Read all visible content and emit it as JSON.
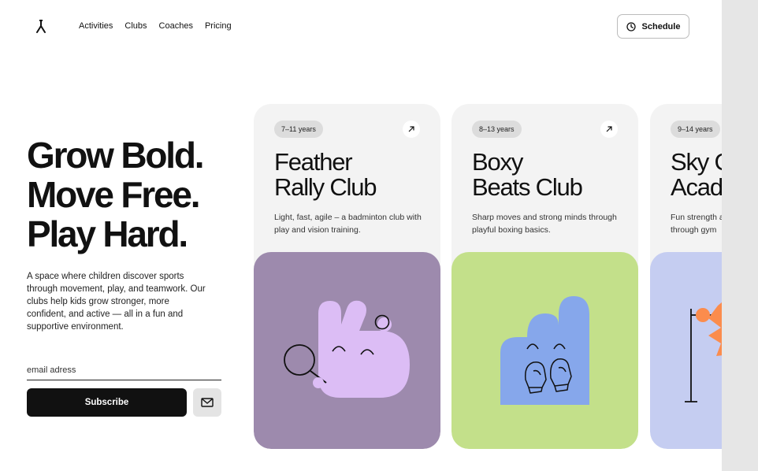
{
  "nav": {
    "items": [
      "Activities",
      "Clubs",
      "Coaches",
      "Pricing"
    ],
    "schedule_label": "Schedule"
  },
  "hero": {
    "title_lines": [
      "Grow Bold.",
      "Move Free.",
      "Play Hard."
    ],
    "description": "A space where children discover sports through movement, play, and teamwork. Our clubs help kids grow stronger, more confident, and active — all in a fun and supportive environment."
  },
  "subscribe": {
    "email_placeholder": "email adress",
    "button_label": "Subscribe"
  },
  "clubs": [
    {
      "age": "7–11 years",
      "title_lines": [
        "Feather",
        "Rally Club"
      ],
      "description": "Light, fast, agile – a badminton club with play and vision training.",
      "art_color": "#9d8aad"
    },
    {
      "age": "8–13 years",
      "title_lines": [
        "Boxy",
        "Beats Club"
      ],
      "description": "Sharp moves and strong minds through playful boxing basics.",
      "art_color": "#c3e08a"
    },
    {
      "age": "9–14 years",
      "title_lines": [
        "Sky Grip",
        "Academy"
      ],
      "description": "Fun strength and endurance on bars and through gym",
      "art_color": "#c5cdf1"
    }
  ],
  "colors": {
    "shape_lilac": "#dcbdf5",
    "shape_blue": "#86a7eb",
    "shape_orange": "#fb8c4d"
  }
}
